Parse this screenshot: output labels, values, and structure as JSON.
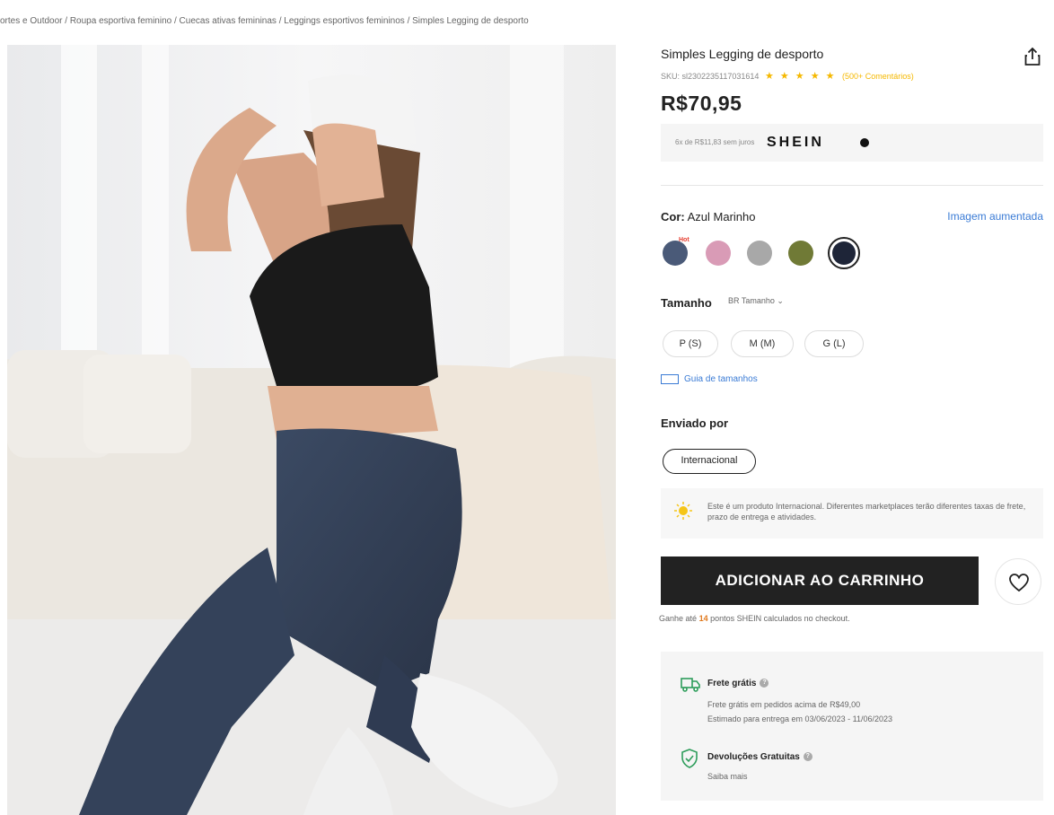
{
  "breadcrumb": "ortes e Outdoor / Roupa esportiva feminino / Cuecas ativas femininas / Leggings esportivos femininos / Simples Legging de desporto",
  "product": {
    "title": "Simples Legging de desporto",
    "sku": "SKU: sl2302235117031614",
    "rating": 5,
    "stars": "★ ★ ★ ★ ★",
    "reviews": "(500+ Comentários)",
    "price": "R$70,95",
    "installments": "6x de R$11,83 sem juros",
    "installment_brand": "SHEIN"
  },
  "color": {
    "label": "Cor:",
    "selected": "Azul Marinho",
    "zoom_link": "Imagem aumentada",
    "hot_badge": "Hot",
    "swatches": [
      "#4a5a78",
      "#d99bb6",
      "#a8a8a8",
      "#707a36",
      "#1e2538"
    ]
  },
  "size": {
    "label": "Tamanho",
    "select": "BR Tamanho ⌄",
    "options": [
      "P (S)",
      "M (M)",
      "G (L)"
    ],
    "guide": "Guia de tamanhos"
  },
  "shipping": {
    "label": "Enviado por",
    "origin": "Internacional",
    "notice": "Este é um produto Internacional. Diferentes marketplaces terão diferentes taxas de frete, prazo de entrega e atividades."
  },
  "cart": {
    "add_label": "ADICIONAR AO CARRINHO",
    "points_prefix": "Ganhe até",
    "points_value": "14",
    "points_suffix": "pontos SHEIN calculados no checkout."
  },
  "delivery": {
    "free_title": "Frete grátis",
    "free_line1": "Frete grátis em pedidos acima de R$49,00",
    "free_line2": "Estimado para entrega em 03/06/2023 - 11/06/2023",
    "returns_title": "Devoluções Gratuitas",
    "returns_link": "Saiba mais",
    "help_glyph": "?"
  },
  "colors": {
    "accent_link": "#3a7bd5",
    "star": "#f5b800",
    "button": "#222222",
    "points": "#e07a1f"
  }
}
